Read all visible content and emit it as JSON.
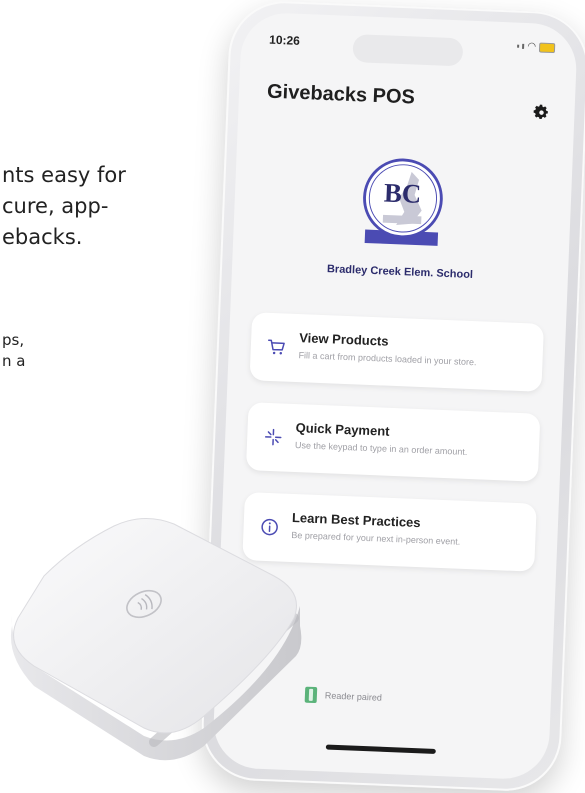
{
  "marketing": {
    "line1": "nts easy for",
    "line2": "cure, app-",
    "line3": "ebacks.",
    "line4": "ps,",
    "line5": "n a"
  },
  "phone": {
    "status_time": "10:26",
    "app_title": "Givebacks POS",
    "school_name": "Bradley Creek Elem. School",
    "logo_text": "BC",
    "cards": [
      {
        "title": "View Products",
        "subtitle": "Fill a cart from products loaded in your store.",
        "icon": "cart-icon"
      },
      {
        "title": "Quick Payment",
        "subtitle": "Use the keypad to type in an order amount.",
        "icon": "sparkle-icon"
      },
      {
        "title": "Learn Best Practices",
        "subtitle": "Be prepared for your next in-person event.",
        "icon": "info-icon"
      }
    ],
    "reader_status": "Reader paired"
  },
  "colors": {
    "accent": "#4b4bb3",
    "battery": "#f1c21b",
    "reader_green": "#5bb37a"
  }
}
